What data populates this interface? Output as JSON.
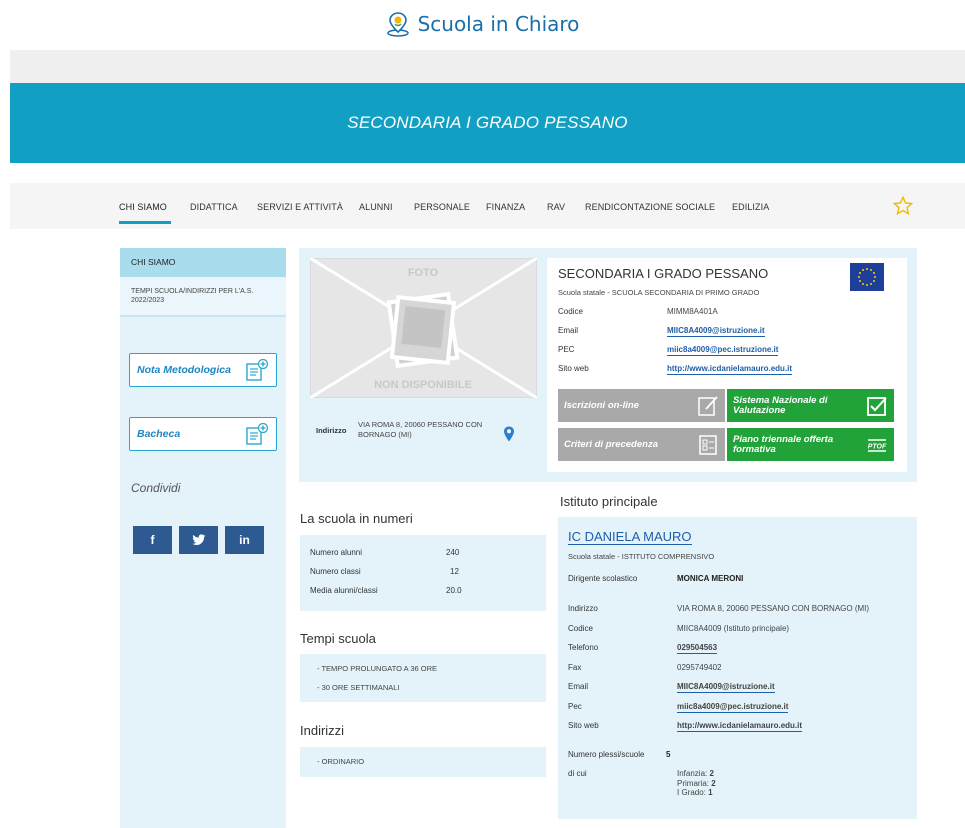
{
  "brand": {
    "name": "Scuola in Chiaro"
  },
  "hero": {
    "title": "SECONDARIA I GRADO PESSANO"
  },
  "nav": {
    "items": [
      "CHI SIAMO",
      "DIDATTICA",
      "SERVIZI E ATTIVITÀ",
      "ALUNNI",
      "PERSONALE",
      "FINANZA",
      "RAV",
      "RENDICONTAZIONE SOCIALE",
      "EDILIZIA"
    ],
    "active": "CHI SIAMO"
  },
  "sidebar": {
    "heading": "CHI SIAMO",
    "sub_item": "TEMPI SCUOLA/INDIRIZZI PER L'A.S. 2022/2023",
    "nota_button": "Nota Metodologica",
    "bacheca_button": "Bacheca",
    "share_label": "Condividi",
    "social": [
      "f",
      "t",
      "in"
    ]
  },
  "photo": {
    "text_top": "FOTO",
    "text_bottom": "NON DISPONIBILE"
  },
  "address": {
    "label": "Indirizzo",
    "value": "VIA ROMA 8, 20060 PESSANO CON BORNAGO (MI)"
  },
  "school": {
    "name": "SECONDARIA I GRADO PESSANO",
    "type": "Scuola statale - SCUOLA SECONDARIA DI PRIMO GRADO",
    "fields": [
      {
        "label": "Codice",
        "value": "MIMM8A401A",
        "link": false
      },
      {
        "label": "Email",
        "value": "MIIC8A4009@istruzione.it",
        "link": true
      },
      {
        "label": "PEC",
        "value": "miic8a4009@pec.istruzione.it",
        "link": true
      },
      {
        "label": "Sito web",
        "value": "http://www.icdanielamauro.edu.it",
        "link": true
      }
    ]
  },
  "actions": {
    "iscrizioni": "Iscrizioni on-line",
    "snv": "Sistema Nazionale di Valutazione",
    "criteri": "Criteri di precedenza",
    "ptof": "Piano triennale offerta formativa",
    "ptof_icon_text": "PTOF"
  },
  "numbers": {
    "title": "La scuola in numeri",
    "rows": [
      {
        "label": "Numero alunni",
        "value": "240"
      },
      {
        "label": "Numero classi",
        "value": "12"
      },
      {
        "label": "Media alunni/classi",
        "value": "20.0"
      }
    ]
  },
  "tempi": {
    "title": "Tempi scuola",
    "items": [
      "- TEMPO PROLUNGATO A 36 ORE",
      "- 30 ORE SETTIMANALI"
    ]
  },
  "indirizzi": {
    "title": "Indirizzi",
    "items": [
      "- ORDINARIO"
    ]
  },
  "istituto": {
    "section_title": "Istituto principale",
    "name": "IC DANIELA MAURO",
    "type": "Scuola statale - ISTITUTO COMPRENSIVO",
    "dirigente_label": "Dirigente scolastico",
    "dirigente_value": "MONICA MERONI",
    "fields": [
      {
        "label": "Indirizzo",
        "value": "VIA ROMA 8, 20060 PESSANO CON BORNAGO (MI)",
        "link": false
      },
      {
        "label": "Codice",
        "value": "MIIC8A4009 (Istituto principale)",
        "link": false
      },
      {
        "label": "Telefono",
        "value": "029504563",
        "link": true
      },
      {
        "label": "Fax",
        "value": "0295749402",
        "link": false
      },
      {
        "label": "Email",
        "value": "MIIC8A4009@istruzione.it",
        "link": true
      },
      {
        "label": "Pec",
        "value": "miic8a4009@pec.istruzione.it",
        "link": true
      },
      {
        "label": "Sito web",
        "value": "http://www.icdanielamauro.edu.it",
        "link": true
      }
    ],
    "plessi_label": "Numero plessi/scuole",
    "plessi_value": "5",
    "dicui_label": "di cui",
    "dicui": [
      {
        "label": "Infanzia:",
        "value": "2"
      },
      {
        "label": "Primaria:",
        "value": "2"
      },
      {
        "label": "I Grado:",
        "value": "1"
      }
    ]
  },
  "colors": {
    "accent": "#119fc4",
    "panel": "#e3f3f9",
    "link": "#1f5ea8",
    "green": "#22a33a",
    "grey_button": "#a9a9a9",
    "social": "#2c5a91"
  }
}
